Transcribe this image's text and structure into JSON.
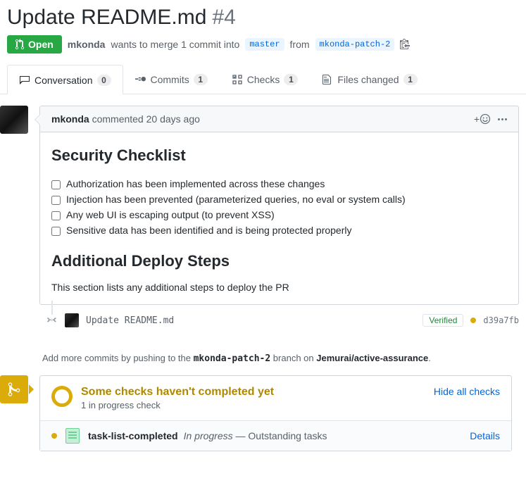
{
  "title": "Update README.md",
  "pr_number": "#4",
  "state": "Open",
  "author": "mkonda",
  "wants_to_merge": "wants to merge 1 commit into",
  "base_branch": "master",
  "from_text": "from",
  "head_branch": "mkonda-patch-2",
  "tabs": {
    "conversation": {
      "label": "Conversation",
      "count": "0"
    },
    "commits": {
      "label": "Commits",
      "count": "1"
    },
    "checks": {
      "label": "Checks",
      "count": "1"
    },
    "files": {
      "label": "Files changed",
      "count": "1"
    }
  },
  "comment": {
    "author": "mkonda",
    "verb": "commented",
    "time": "20 days ago",
    "heading1": "Security Checklist",
    "items": [
      "Authorization has been implemented across these changes",
      "Injection has been prevented (parameterized queries, no eval or system calls)",
      "Any web UI is escaping output (to prevent XSS)",
      "Sensitive data has been identified and is being protected properly"
    ],
    "heading2": "Additional Deploy Steps",
    "body2": "This section lists any additional steps to deploy the PR"
  },
  "commit": {
    "message": "Update README.md",
    "verified": "Verified",
    "sha": "d39a7fb"
  },
  "push_hint": {
    "prefix": "Add more commits by pushing to the ",
    "branch": "mkonda-patch-2",
    "mid": " branch on ",
    "repo": "Jemurai/active-assurance",
    "suffix": "."
  },
  "checks": {
    "title": "Some checks haven't completed yet",
    "subtitle": "1 in progress check",
    "hide": "Hide all checks",
    "item_name": "task-list-completed",
    "item_status": "In progress",
    "item_sep": " — ",
    "item_desc": "Outstanding tasks",
    "details": "Details"
  },
  "reaction_plus": "+"
}
